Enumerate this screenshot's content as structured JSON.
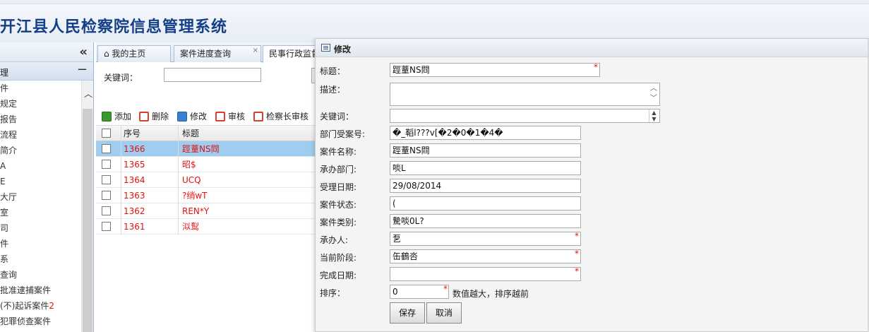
{
  "app": {
    "title": "开江县人民检察院信息管理系统"
  },
  "sidebar": {
    "collapse_icon": "double-chevron-left",
    "group_label": "理",
    "group_toggle": "−",
    "items": [
      {
        "label": "件"
      },
      {
        "label": "规定"
      },
      {
        "label": "报告"
      },
      {
        "label": "流程"
      },
      {
        "label": "简介"
      },
      {
        "label": "A"
      },
      {
        "label": "E"
      },
      {
        "label": "大厅"
      },
      {
        "label": "室"
      },
      {
        "label": "司"
      },
      {
        "label": "件"
      },
      {
        "label": "系"
      },
      {
        "label": "查询"
      },
      {
        "label": "批准逮捕案件"
      },
      {
        "label": "(不)起诉案件",
        "count": "2"
      },
      {
        "label": "犯罪侦查案件"
      }
    ]
  },
  "tabs": [
    {
      "label": "⌂ 我的主页"
    },
    {
      "label": "案件进度查询",
      "close": "×"
    },
    {
      "label": "民事行政监督"
    }
  ],
  "search": {
    "label": "关键词：",
    "value": ""
  },
  "toolbar": {
    "add": "添加",
    "delete": "删除",
    "edit": "修改",
    "audit": "审核",
    "chief_audit": "检察长审核"
  },
  "grid": {
    "headers": {
      "no": "序号",
      "title": "标题",
      "sort_glyph": "△"
    },
    "rows": [
      {
        "no": "1366",
        "title": "踁蕫NS閰",
        "selected": true
      },
      {
        "no": "1365",
        "title": "昭$",
        "selected": false
      },
      {
        "no": "1364",
        "title": "UCQ",
        "selected": false
      },
      {
        "no": "1363",
        "title": "?绡wT",
        "selected": false
      },
      {
        "no": "1362",
        "title": "REN*Y",
        "selected": false
      },
      {
        "no": "1361",
        "title": "泤䴕",
        "selected": false
      }
    ]
  },
  "dialog": {
    "title": "修改",
    "fields": {
      "title_label": "标题：",
      "title_value": "踁蕫NS閰",
      "desc_label": "描述：",
      "desc_value": "",
      "keywords_label": "关键词：",
      "keywords_value": "",
      "dept_case_no_label": "部门受案号:",
      "dept_case_no_value": "�_鞱l???v[�2�0�1�4�",
      "case_name_label": "案件名称:",
      "case_name_value": "踁蕫NS閰",
      "dept_label": "承办部门:",
      "dept_value": "啖L",
      "accept_date_label": "受理日期:",
      "accept_date_value": "29/08/2014",
      "status_label": "案件状态:",
      "status_value": "(",
      "category_label": "案件类别:",
      "category_value": "驇啖0L?",
      "handler_label": "承办人:",
      "handler_value": "乭",
      "stage_label": "当前阶段:",
      "stage_value": "缶鶴呇",
      "complete_date_label": "完成日期:",
      "complete_date_value": "",
      "order_label": "排序：",
      "order_value": "0",
      "order_hint": "数值越大，排序越前"
    },
    "required_mark": "*",
    "save": "保存",
    "cancel": "取消"
  },
  "colors": {
    "title_blue": "#143e87",
    "selected_row": "#9ecdf0",
    "red_text": "#e21010"
  }
}
